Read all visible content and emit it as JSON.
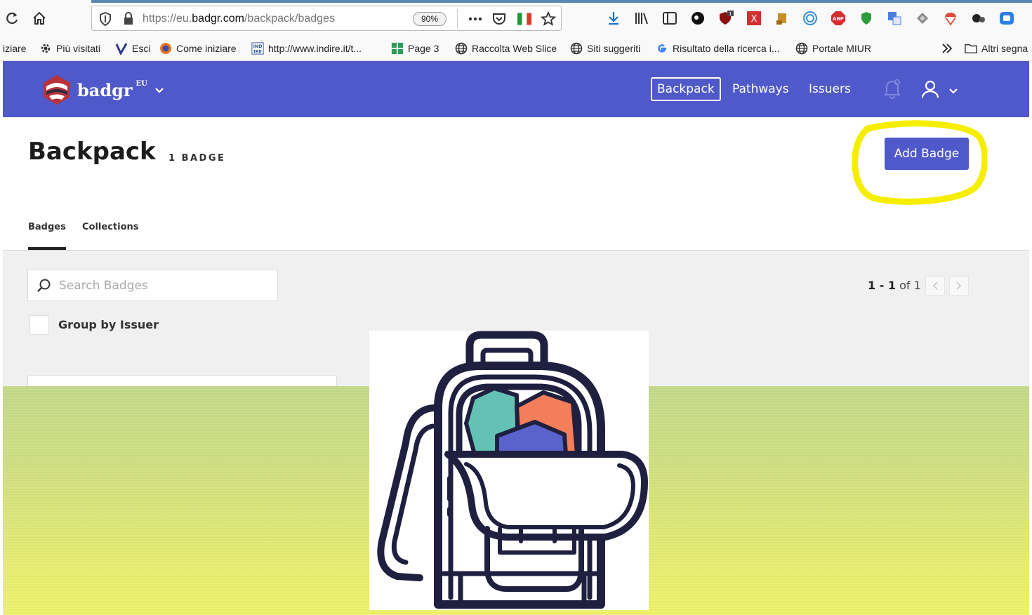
{
  "browser": {
    "url_prefix": "https://eu.",
    "url_host": "badgr.com",
    "url_path": "/backpack/badges",
    "zoom": "90%",
    "bookmarks": [
      {
        "label": "iziare"
      },
      {
        "label": "Più visitati"
      },
      {
        "label": "Esci"
      },
      {
        "label": "Come iniziare"
      },
      {
        "label": "http://www.indire.it/t..."
      },
      {
        "label": "Page 3"
      },
      {
        "label": "Raccolta Web Slice"
      },
      {
        "label": "Siti suggeriti"
      },
      {
        "label": "Risultato della ricerca i..."
      },
      {
        "label": "Portale MIUR"
      }
    ],
    "more_bookmarks": "Altri segna"
  },
  "app": {
    "brand": "badgr",
    "brand_region": "EU",
    "nav": {
      "backpack": "Backpack",
      "pathways": "Pathways",
      "issuers": "Issuers"
    },
    "colors": {
      "primary": "#5059c9",
      "highlight": "#f5ee00"
    }
  },
  "page": {
    "title": "Backpack",
    "badge_count": "1 BADGE",
    "add_badge": "Add Badge",
    "tabs": {
      "badges": "Badges",
      "collections": "Collections"
    },
    "search_placeholder": "Search Badges",
    "group_by": "Group by Issuer",
    "pager": {
      "range": "1 - 1",
      "of": "of 1"
    }
  }
}
